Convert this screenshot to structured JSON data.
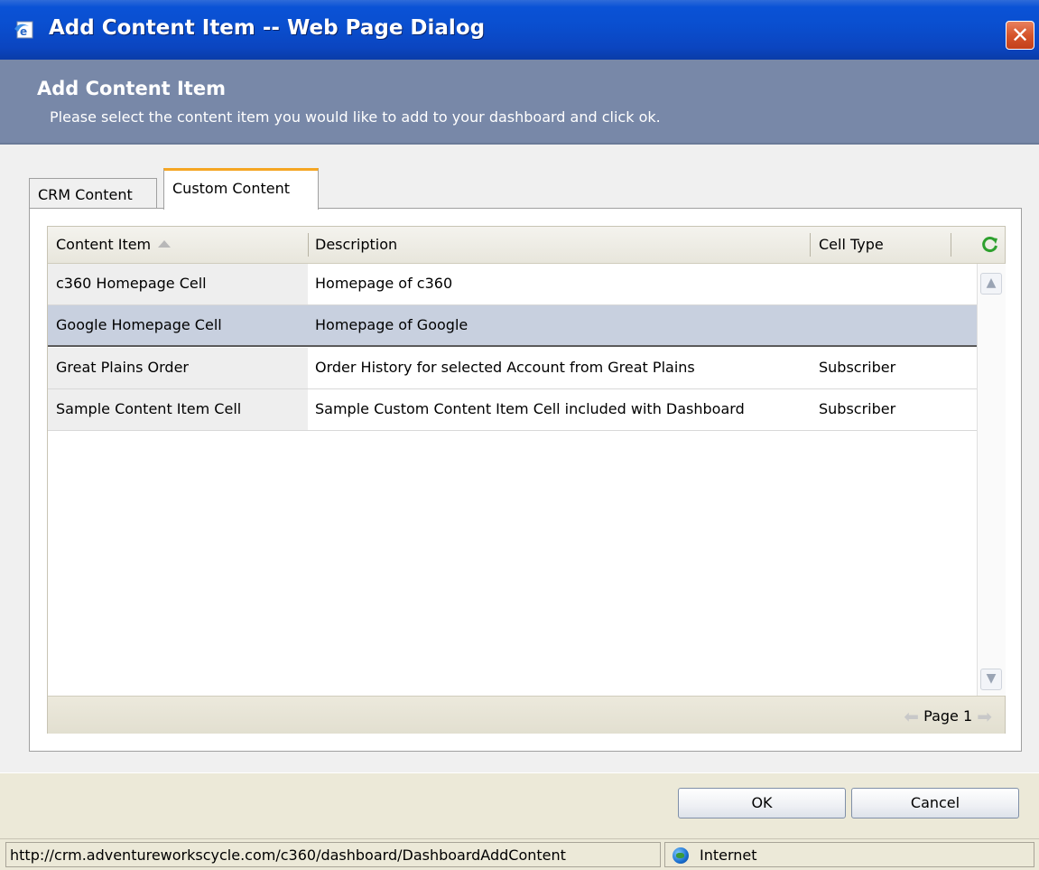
{
  "window": {
    "title": "Add Content Item -- Web Page Dialog"
  },
  "header": {
    "title": "Add Content Item",
    "subtitle": "Please select the content item you would like to add to your dashboard and click ok."
  },
  "tabs": [
    {
      "label": "CRM Content",
      "active": false
    },
    {
      "label": "Custom Content",
      "active": true
    }
  ],
  "grid": {
    "columns": [
      "Content Item",
      "Description",
      "Cell Type"
    ],
    "sort_column": "Content Item",
    "sort_direction": "ascending",
    "rows": [
      {
        "item": "c360 Homepage Cell",
        "description": "Homepage of c360",
        "type": ""
      },
      {
        "item": "Google Homepage Cell",
        "description": "Homepage of Google",
        "type": ""
      },
      {
        "item": "Great Plains Order",
        "description": "Order History for selected Account from Great Plains",
        "type": "Subscriber"
      },
      {
        "item": "Sample Content Item Cell",
        "description": "Sample Custom Content Item Cell included with Dashboard",
        "type": "Subscriber"
      }
    ],
    "selected_row": 1,
    "pager": "Page 1"
  },
  "buttons": {
    "ok": "OK",
    "cancel": "Cancel"
  },
  "status": {
    "url": "http://crm.adventureworkscycle.com/c360/dashboard/DashboardAddContent",
    "zone": "Internet"
  },
  "colors": {
    "titlebar": "#0a52d6",
    "header_band": "#7888a8",
    "active_tab_accent": "#f5a623",
    "selected_row": "#c8d0df",
    "refresh_icon": "#2ea02e"
  },
  "icons": [
    "ie-page-icon",
    "close-icon",
    "sort-ascending-icon",
    "refresh-icon",
    "scroll-up-icon",
    "scroll-down-icon",
    "page-prev-icon",
    "page-next-icon",
    "internet-globe-icon"
  ]
}
